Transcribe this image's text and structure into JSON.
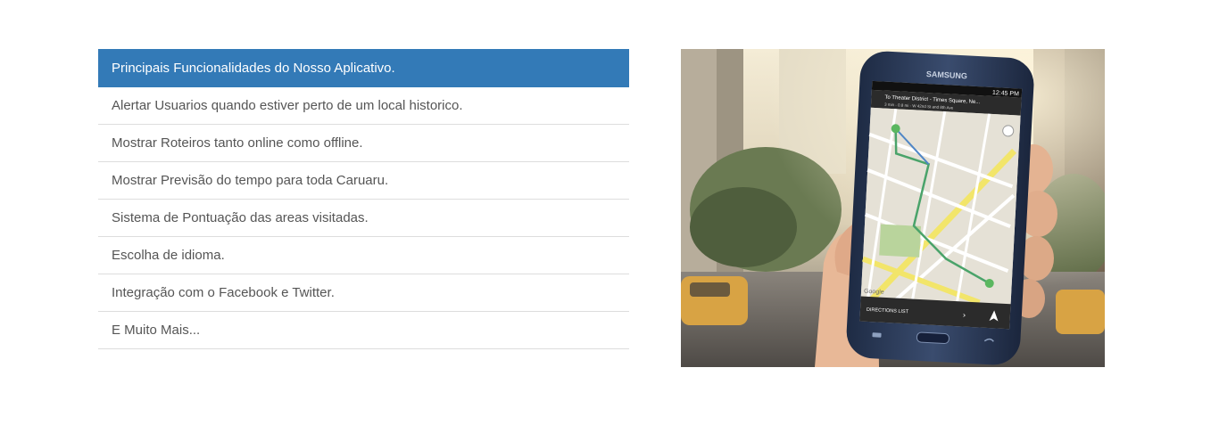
{
  "features": {
    "header": "Principais Funcionalidades do Nosso Aplicativo.",
    "items": [
      "Alertar Usuarios quando estiver perto de um local historico.",
      "Mostrar Roteiros tanto online como offline.",
      "Mostrar Previsão do tempo para toda Caruaru.",
      "Sistema de Pontuação das areas visitadas.",
      "Escolha de idioma.",
      "Integração com o Facebook e Twitter.",
      "E Muito Mais..."
    ]
  },
  "phone": {
    "brand": "SAMSUNG",
    "time": "12:45 PM",
    "map_destination": "To Theater District - Times Square, Ne...",
    "map_subtitle": "3 min - 0.8 mi - W 42nd St and 8th Ave",
    "directions_label": "DIRECTIONS LIST",
    "map_watermark": "Google"
  },
  "colors": {
    "accent": "#337ab7",
    "text": "#555555",
    "divider": "#dddddd"
  }
}
